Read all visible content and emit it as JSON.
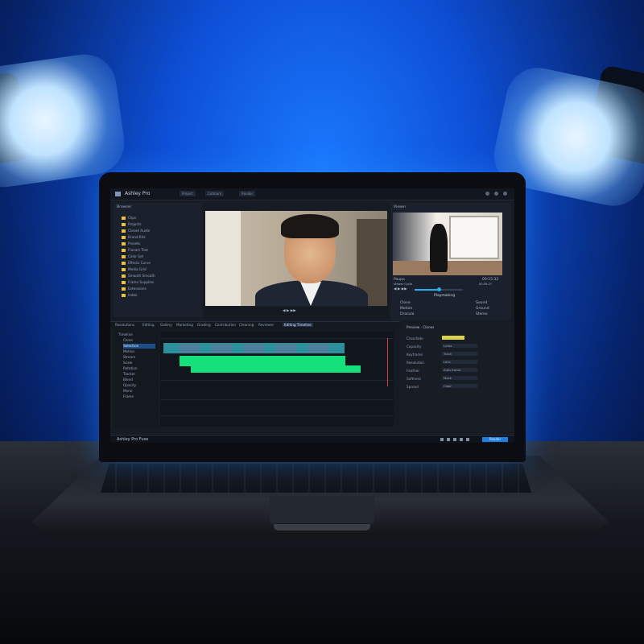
{
  "app": {
    "title": "Ashley Pro",
    "status_title": "Ashley Pro Fuse",
    "status_action": "Render"
  },
  "top_tabs": [
    "Project",
    "Cutmark",
    "Render"
  ],
  "media_panel": {
    "title": "Browser",
    "items": [
      "Clips",
      "Projects",
      "Closed Audio",
      "Brand Kits",
      "Presets",
      "Flavors Text",
      "Color Set",
      "Effects Curve",
      "Media Grid",
      "Smooth Smooth",
      "Frame Supplies",
      "Extensions",
      "Index"
    ]
  },
  "preview_panel": {
    "title": "Viewer",
    "clip_name": "Paupo",
    "clip_sub": "Viewer Cycle",
    "timecode": "00:15:32",
    "timecode_sub": "00:35:27",
    "section": "Playmaking",
    "progress": 0.5,
    "rows": [
      {
        "label": "Clone",
        "value": "Sound"
      },
      {
        "label": "Motion",
        "value": "Ground"
      },
      {
        "label": "Dracula",
        "value": "Stereo"
      }
    ]
  },
  "bottom_tabs": [
    "Resolutions",
    "Editing",
    "Gallery",
    "Marketing",
    "Grading",
    "Contribution",
    "Cleaning",
    "Reviewer",
    "Editing Timeline"
  ],
  "track_list": [
    "Timeline",
    "Clone",
    "Selection",
    "Motion",
    "Stream",
    "Scale",
    "Rotation",
    "Tracker",
    "Blend",
    "Opacity",
    "Mono",
    "Frame"
  ],
  "inspector": {
    "title": "Preview · Clones",
    "rows": [
      {
        "label": "Crossfade",
        "value": ""
      },
      {
        "label": "Capacity",
        "value": "Luma"
      },
      {
        "label": "Keyframe",
        "value": "Track"
      },
      {
        "label": "Resolution",
        "value": "Lens"
      },
      {
        "label": "Feather",
        "value": "Auto frame"
      },
      {
        "label": "Softness",
        "value": "Mask"
      },
      {
        "label": "Spread",
        "value": "Color"
      }
    ]
  },
  "colors": {
    "accent": "#23b1e8",
    "clip_green": "#15e07b",
    "playhead": "#e03d4a"
  }
}
